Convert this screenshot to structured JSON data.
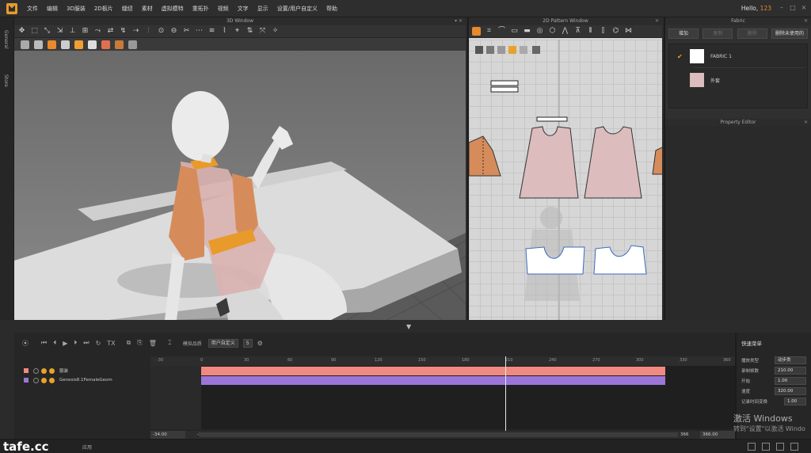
{
  "app": {
    "greeting_prefix": "Hello,",
    "user": "123",
    "window_buttons": [
      "–",
      "□",
      "×"
    ]
  },
  "menu": [
    "文件",
    "编辑",
    "3D服装",
    "2D板片",
    "缝纫",
    "素材",
    "虚拟模特",
    "重拓扑",
    "视频",
    "文字",
    "显示",
    "设置/用户自定义",
    "帮助"
  ],
  "side_tabs": [
    "General",
    "Store"
  ],
  "window3d": {
    "title": "3D Window",
    "axis_label": "0"
  },
  "window2d": {
    "title": "2D Pattern Window"
  },
  "fabric": {
    "title": "Fabric",
    "buttons": [
      {
        "label": "增加",
        "enabled": true
      },
      {
        "label": "复制",
        "enabled": false
      },
      {
        "label": "删除",
        "enabled": false
      },
      {
        "label": "删除未使用的",
        "enabled": true
      }
    ],
    "items": [
      {
        "name": "FABRIC 1",
        "color": "#ffffff",
        "checked": true
      },
      {
        "name": "外套",
        "color": "#dcbcbc",
        "checked": false
      }
    ]
  },
  "property_editor": {
    "title": "Property Editor"
  },
  "animation": {
    "mode_label": "模拟品质",
    "mode_value": "用户自定义",
    "steps_value": "5",
    "ruler_ticks": [
      "-30",
      "0",
      "30",
      "60",
      "90",
      "120",
      "150",
      "180",
      "210",
      "240",
      "270",
      "300",
      "330",
      "360"
    ],
    "tracks": [
      {
        "name": "服装",
        "color": "#f08a80"
      },
      {
        "name": "Genesis8.1FemaleGeom",
        "color": "#9b76d8"
      }
    ],
    "start_value": "-34.00",
    "start_value2": "-34",
    "end_value": "366",
    "end_value2": "366.00",
    "tool_text": "TX"
  },
  "quick_menu": {
    "title": "快速菜单",
    "rows": [
      {
        "label": "播放类型",
        "value": "动步类"
      },
      {
        "label": "录制帧数",
        "value": "210.00"
      },
      {
        "label": "开始",
        "value": "1.00"
      },
      {
        "label": "速度",
        "value": "320.00"
      },
      {
        "label": "记录时间变换",
        "value": "1.00"
      }
    ]
  },
  "watermark": {
    "line1": "激活 Windows",
    "line2": "转到\"设置\"以激活 Windo"
  },
  "status_bar": {
    "brand": "tafe.cc",
    "text": "应用"
  },
  "colors": {
    "accent": "#e8892b",
    "garment": "#dcbcbc",
    "orange_fabric": "#d68c5a",
    "track_pink": "#f08a80",
    "track_purple": "#9b76d8"
  }
}
